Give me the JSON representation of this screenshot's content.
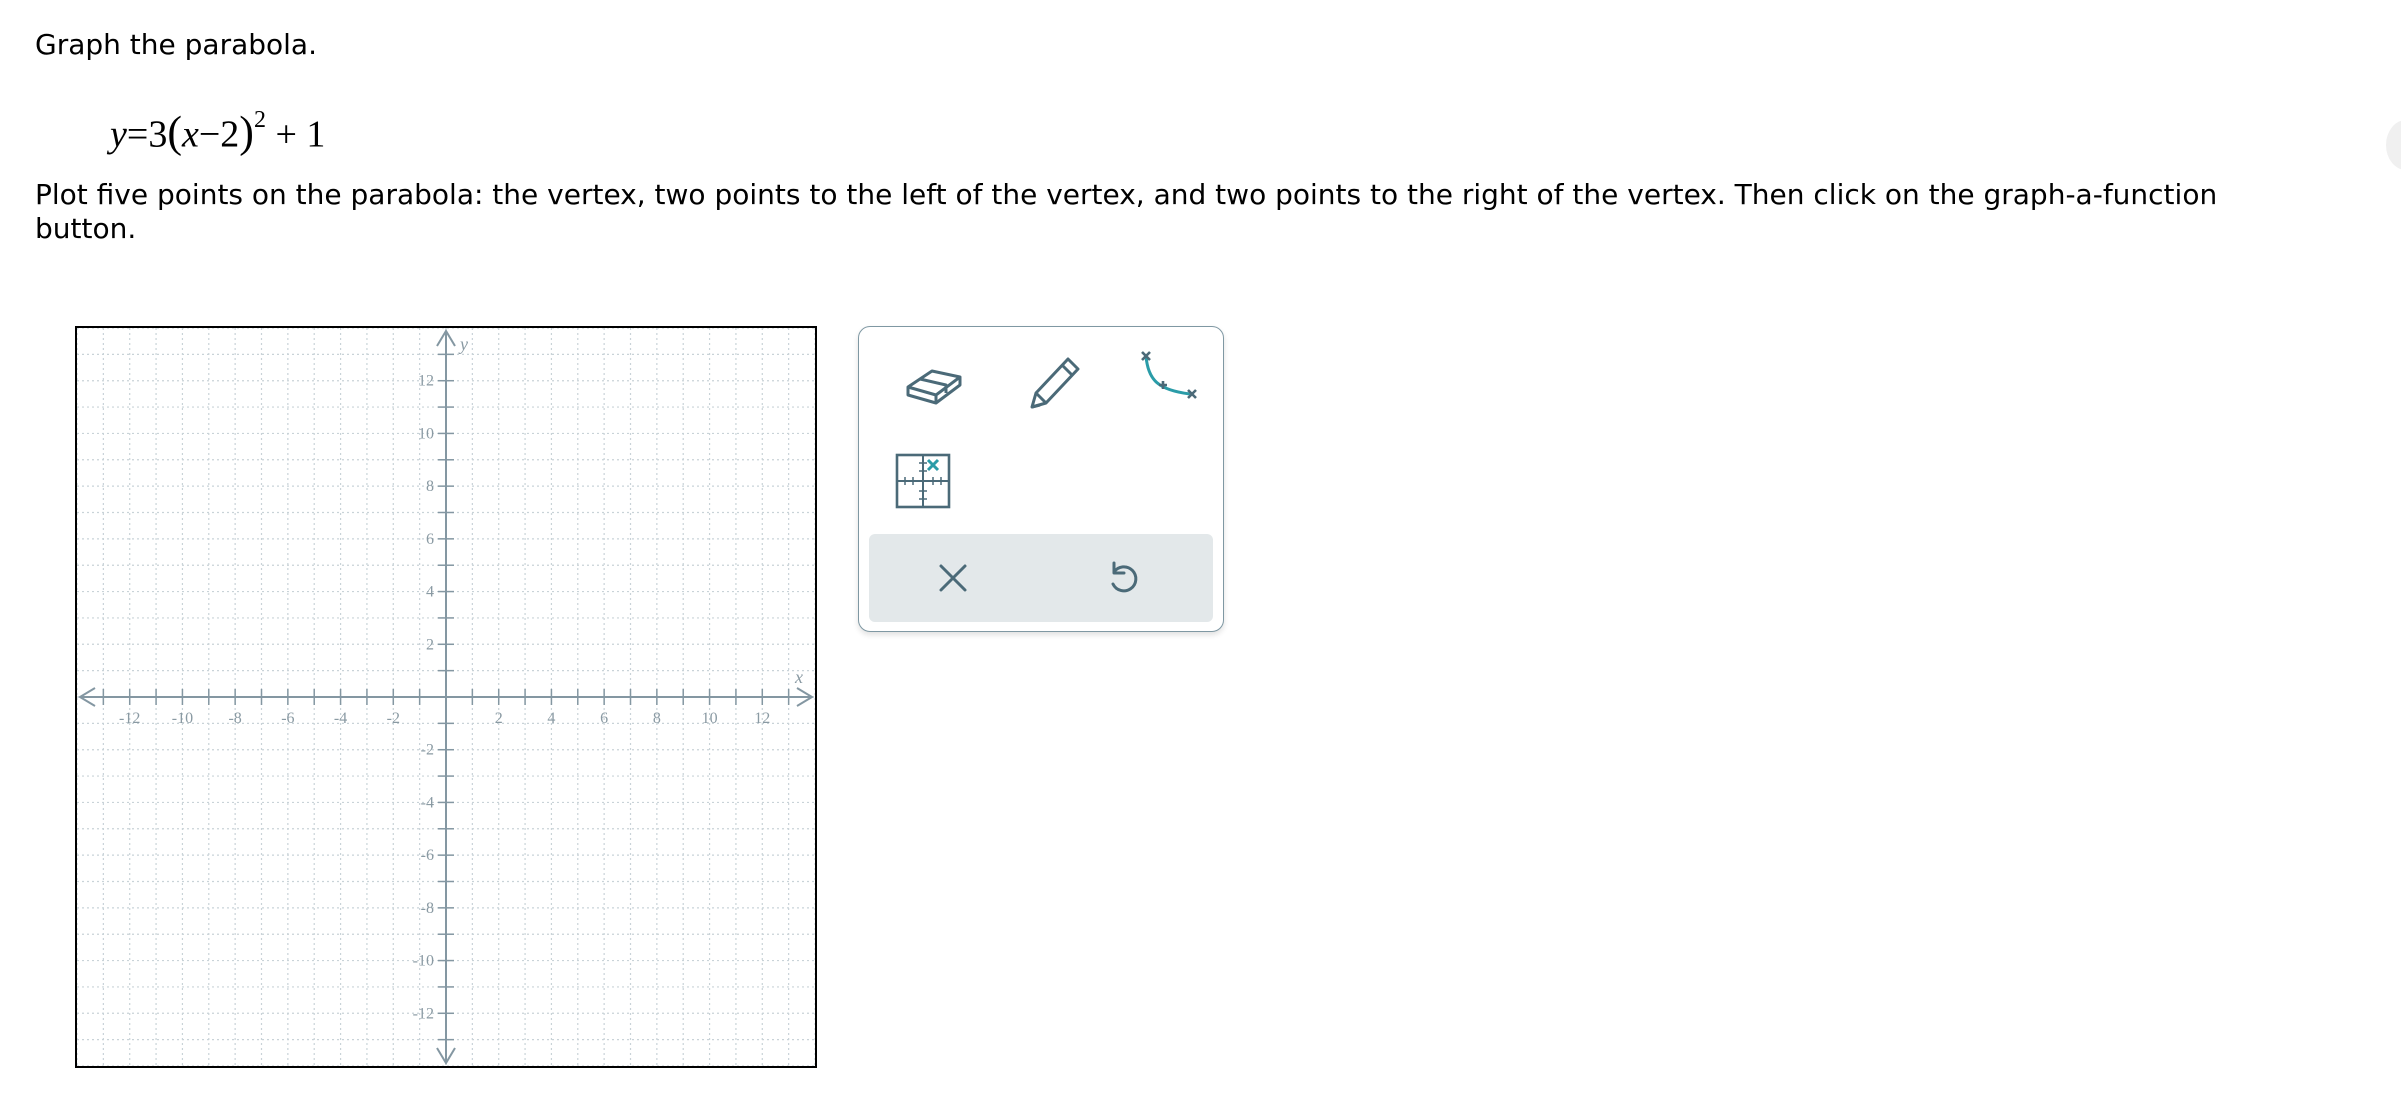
{
  "prompt": {
    "heading": "Graph the parabola.",
    "equation": {
      "y": "y",
      "equals": "=",
      "coef": "3",
      "open": "(",
      "x": "x",
      "minus": "−",
      "h": "2",
      "close": ")",
      "exp": "2",
      "plus": "+",
      "k": "1"
    },
    "instructions": "Plot five points on the parabola: the vertex, two points to the left of the vertex, and two points to the right of the vertex. Then click on the graph-a-function button."
  },
  "graph": {
    "x_axis_label": "x",
    "y_axis_label": "y",
    "x_range": [
      -14,
      14
    ],
    "y_range": [
      -14,
      14
    ],
    "grid_step": 1,
    "x_tick_labels": [
      "-12",
      "-10",
      "-8",
      "-6",
      "-4",
      "-2",
      "2",
      "4",
      "6",
      "8",
      "10",
      "12"
    ],
    "y_tick_labels": [
      "12",
      "10",
      "8",
      "6",
      "4",
      "2",
      "-2",
      "-4",
      "-6",
      "-8",
      "-10",
      "-12"
    ],
    "axis_color": "#8497a2",
    "grid_color": "#c9d3d8"
  },
  "toolbox": {
    "tools": [
      {
        "name": "eraser-icon",
        "interactive": true
      },
      {
        "name": "pencil-icon",
        "interactive": true
      },
      {
        "name": "graph-function-icon",
        "interactive": true
      },
      {
        "name": "grid-point-icon",
        "interactive": true
      }
    ],
    "actions": [
      {
        "name": "clear-icon"
      },
      {
        "name": "undo-icon"
      }
    ],
    "icon_color": "#4b6a78",
    "accent_color": "#2a9ca8"
  }
}
